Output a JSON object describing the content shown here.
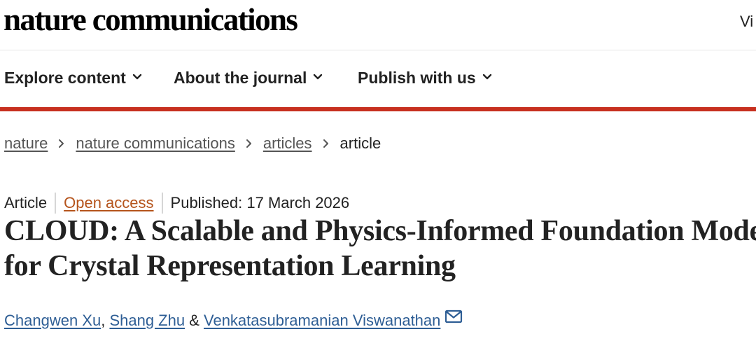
{
  "header": {
    "logo_text": "nature communications",
    "right_link_partial": "Vi"
  },
  "nav": {
    "items": [
      {
        "label": "Explore content",
        "icon": "chevron-down-icon"
      },
      {
        "label": "About the journal",
        "icon": "chevron-down-icon"
      },
      {
        "label": "Publish with us",
        "icon": "chevron-down-icon"
      }
    ],
    "accent_color": "#c7301f"
  },
  "breadcrumb": {
    "items": [
      "nature",
      "nature communications",
      "articles"
    ],
    "current": "article",
    "separator_icon": "chevron-right-icon"
  },
  "article": {
    "type": "Article",
    "access": "Open access",
    "access_color": "#b5541c",
    "published": "Published: 17 March 2026",
    "title": "CLOUD: A Scalable and Physics-Informed Foundation Model for Crystal Representation Learning",
    "authors": [
      {
        "name": "Changwen Xu",
        "suffix": ", "
      },
      {
        "name": "Shang Zhu",
        "suffix": " & "
      },
      {
        "name": "Venkatasubramanian Viswanathan",
        "suffix": ""
      }
    ],
    "author_link_color": "#2e5e95",
    "corresponding_icon": "mail-icon"
  }
}
